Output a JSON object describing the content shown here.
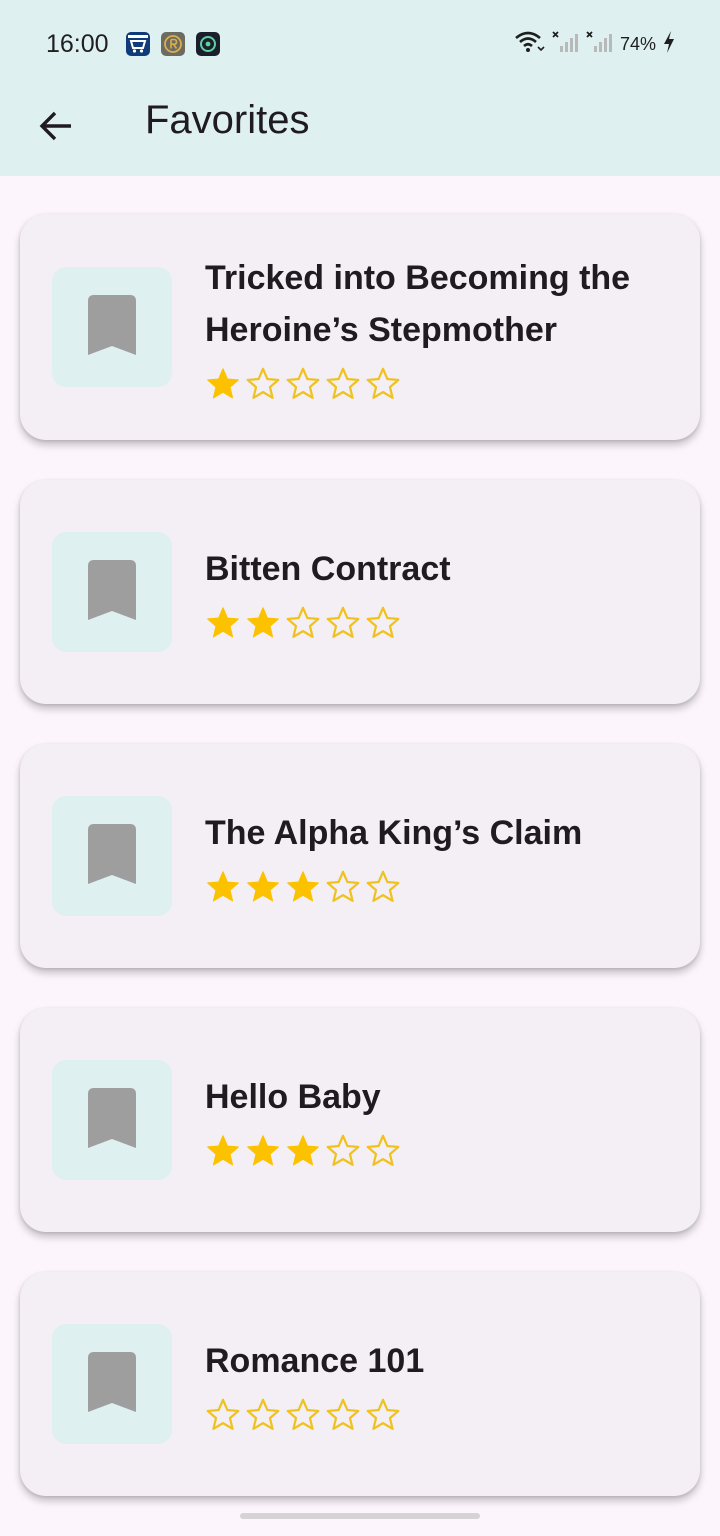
{
  "status_bar": {
    "time": "16:00",
    "battery": "74%",
    "icons": [
      "amazon-shopping-icon",
      "r-app-icon",
      "shield-app-icon",
      "wifi-icon",
      "signal-icon",
      "signal-icon",
      "charging-icon"
    ]
  },
  "app_bar": {
    "title": "Favorites",
    "back_icon": "arrow-back-icon"
  },
  "colors": {
    "star_filled": "#fcc200",
    "star_outline": "#f0c21f",
    "bookmark": "#9e9e9e",
    "thumb_bg": "#dff0f0",
    "card_bg": "#f4eff5",
    "app_bar_bg": "#dff0f0",
    "page_bg": "#fcf6fc"
  },
  "favorites": [
    {
      "title": "Tricked into Becoming the Heroine’s Stepmother",
      "rating": 1,
      "max_rating": 5,
      "icon": "bookmark-icon"
    },
    {
      "title": "Bitten Contract",
      "rating": 2,
      "max_rating": 5,
      "icon": "bookmark-icon"
    },
    {
      "title": "The Alpha King’s Claim",
      "rating": 3,
      "max_rating": 5,
      "icon": "bookmark-icon"
    },
    {
      "title": "Hello Baby",
      "rating": 3,
      "max_rating": 5,
      "icon": "bookmark-icon"
    },
    {
      "title": "Romance 101",
      "rating": 0,
      "max_rating": 5,
      "icon": "bookmark-icon"
    }
  ]
}
